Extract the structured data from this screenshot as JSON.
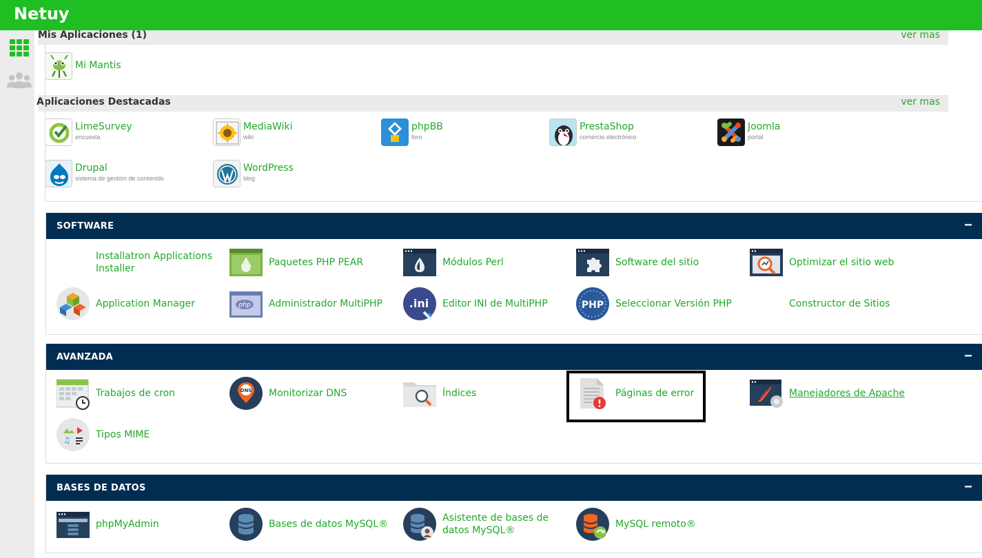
{
  "brand": "Netuy",
  "sidebar": {
    "items": [
      {
        "icon": "grid-icon"
      },
      {
        "icon": "users-icon"
      }
    ]
  },
  "my_apps": {
    "title": "Mis Aplicaciones (1)",
    "more": "ver mas",
    "apps": [
      {
        "name": "Mi Mantis",
        "icon": "mantis-logo"
      }
    ]
  },
  "featured": {
    "title": "Aplicaciones Destacadas",
    "more": "ver mas",
    "apps": [
      {
        "name": "LimeSurvey",
        "sub": "encuesta",
        "icon": "limesurvey-logo"
      },
      {
        "name": "MediaWiki",
        "sub": "wiki",
        "icon": "mediawiki-logo"
      },
      {
        "name": "phpBB",
        "sub": "foro",
        "icon": "phpbb-logo"
      },
      {
        "name": "PrestaShop",
        "sub": "comercio electrónico",
        "icon": "prestashop-logo"
      },
      {
        "name": "Joomla",
        "sub": "portal",
        "icon": "joomla-logo"
      },
      {
        "name": "Drupal",
        "sub": "sistema de gestión de contenido",
        "icon": "drupal-logo"
      },
      {
        "name": "WordPress",
        "sub": "blog",
        "icon": "wordpress-logo"
      }
    ]
  },
  "software": {
    "title": "SOFTWARE",
    "collapse": "−",
    "items": [
      {
        "label": "Installatron Applications Installer"
      },
      {
        "label": "Paquetes PHP PEAR",
        "icon": "php-pear-icon"
      },
      {
        "label": "Módulos Perl",
        "icon": "perl-icon"
      },
      {
        "label": "Software del sitio",
        "icon": "puzzle-icon"
      },
      {
        "label": "Optimizar el sitio web",
        "icon": "optimize-icon"
      },
      {
        "label": "Application Manager",
        "icon": "app-manager-icon"
      },
      {
        "label": "Administrador MultiPHP",
        "icon": "multiphp-icon"
      },
      {
        "label": "Editor INI de MultiPHP",
        "icon": "ini-icon"
      },
      {
        "label": "Seleccionar Versión PHP",
        "icon": "php-version-icon"
      },
      {
        "label": "Constructor de Sitios"
      }
    ]
  },
  "advanced": {
    "title": "AVANZADA",
    "collapse": "−",
    "items": [
      {
        "label": "Trabajos de cron",
        "icon": "calendar-clock-icon"
      },
      {
        "label": "Monitorizar DNS",
        "icon": "dns-pin-icon"
      },
      {
        "label": "Índices",
        "icon": "folder-search-icon"
      },
      {
        "label": "Páginas de error",
        "icon": "error-page-icon"
      },
      {
        "label": "Manejadores de Apache",
        "icon": "apache-handlers-icon"
      },
      {
        "label": "Tipos MIME",
        "icon": "mime-icon"
      }
    ]
  },
  "databases": {
    "title": "BASES DE DATOS",
    "collapse": "−",
    "items": [
      {
        "label": "phpMyAdmin",
        "icon": "phpmyadmin-icon"
      },
      {
        "label": "Bases de datos MySQL®",
        "icon": "mysql-db-icon"
      },
      {
        "label": "Asistente de bases de datos MySQL®",
        "icon": "mysql-wizard-icon"
      },
      {
        "label": "MySQL remoto®",
        "icon": "mysql-remote-icon"
      }
    ]
  },
  "colors": {
    "brand_green": "#1fbf24",
    "link_green": "#22a82a",
    "panel_navy": "#012d51"
  }
}
